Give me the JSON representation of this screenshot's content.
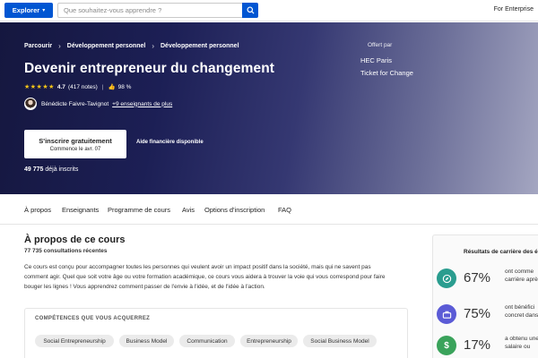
{
  "topbar": {
    "explore_label": "Explorer",
    "search_placeholder": "Que souhaitez-vous apprendre ?",
    "enterprise_label": "For Enterprise"
  },
  "hero": {
    "breadcrumb": [
      "Parcourir",
      "Développement personnel",
      "Développement personnel"
    ],
    "title": "Devenir entrepreneur du changement",
    "rating": "4.7",
    "stars_value": 4.7,
    "notes": "(417 notes)",
    "like_pct": "98 %",
    "instructor": "Bénédicte Faivre-Tavignot",
    "more_instructors": "+9 enseignants de plus",
    "enroll_label": "S'inscrire gratuitement",
    "enroll_sub": "Commence le avr. 07",
    "financial_aid": "Aide financière disponible",
    "enrolled_count": "49 775",
    "enrolled_suffix": "déjà inscrits",
    "offered_by_label": "Offert par",
    "offered_by": [
      "HEC Paris",
      "Ticket for Change"
    ]
  },
  "tabs": [
    "À propos",
    "Enseignants",
    "Programme de cours",
    "Avis",
    "Options d'inscription",
    "FAQ"
  ],
  "about": {
    "title": "À propos de ce cours",
    "views": "77 735 consultations récentes",
    "description": "Ce cours est conçu pour accompagner toutes les personnes qui veulent avoir un impact positif dans la société, mais qui ne savent pas comment agir. Quel que soit votre âge ou votre formation académique, ce cours vous aidera à trouver la voie qui vous correspond pour faire bouger les lignes ! Vous apprendrez comment passer de l'envie à l'idée, et de l'idée à l'action.",
    "skills_title": "COMPÉTENCES QUE VOUS ACQUERREZ",
    "skills": [
      "Social Entrepreneurship",
      "Business Model",
      "Communication",
      "Entrepreneurship",
      "Social Business Model"
    ]
  },
  "career": {
    "title": "Résultats de carrière des é",
    "rows": [
      {
        "pct": "67%",
        "line1": "ont comme",
        "line2": "carrière aprè",
        "line3": "c",
        "color": "#2a9d8f",
        "icon": "compass-icon"
      },
      {
        "pct": "75%",
        "line1": "ont bénéfici",
        "line2": "concret dans l",
        "line3": "c",
        "color": "#5b5bd6",
        "icon": "briefcase-icon"
      },
      {
        "pct": "17%",
        "line1": "a obtenu une",
        "line2": "salaire ou",
        "line3": "",
        "color": "#3aa35b",
        "icon": "dollar-icon"
      }
    ]
  },
  "colors": {
    "accent": "#0056d2",
    "star": "#f5c518"
  }
}
